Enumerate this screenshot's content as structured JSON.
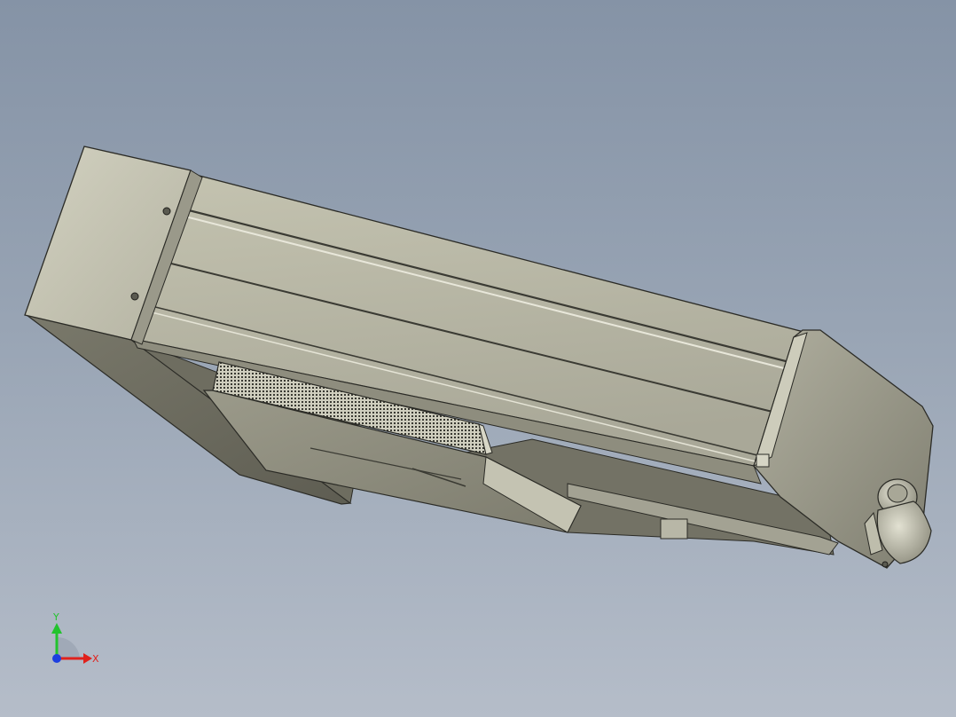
{
  "axis_triad": {
    "x_label": "X",
    "y_label": "Y"
  },
  "colors": {
    "background_top": "#8593a6",
    "background_bottom": "#b5bdc9",
    "part_light": "#c9c8b6",
    "part_mid": "#a9a898",
    "part_dark": "#7d7c6e",
    "edge": "#2b2b26",
    "axis_x": "#e0211c",
    "axis_y": "#22c32e",
    "axis_z": "#1d3fe0"
  }
}
